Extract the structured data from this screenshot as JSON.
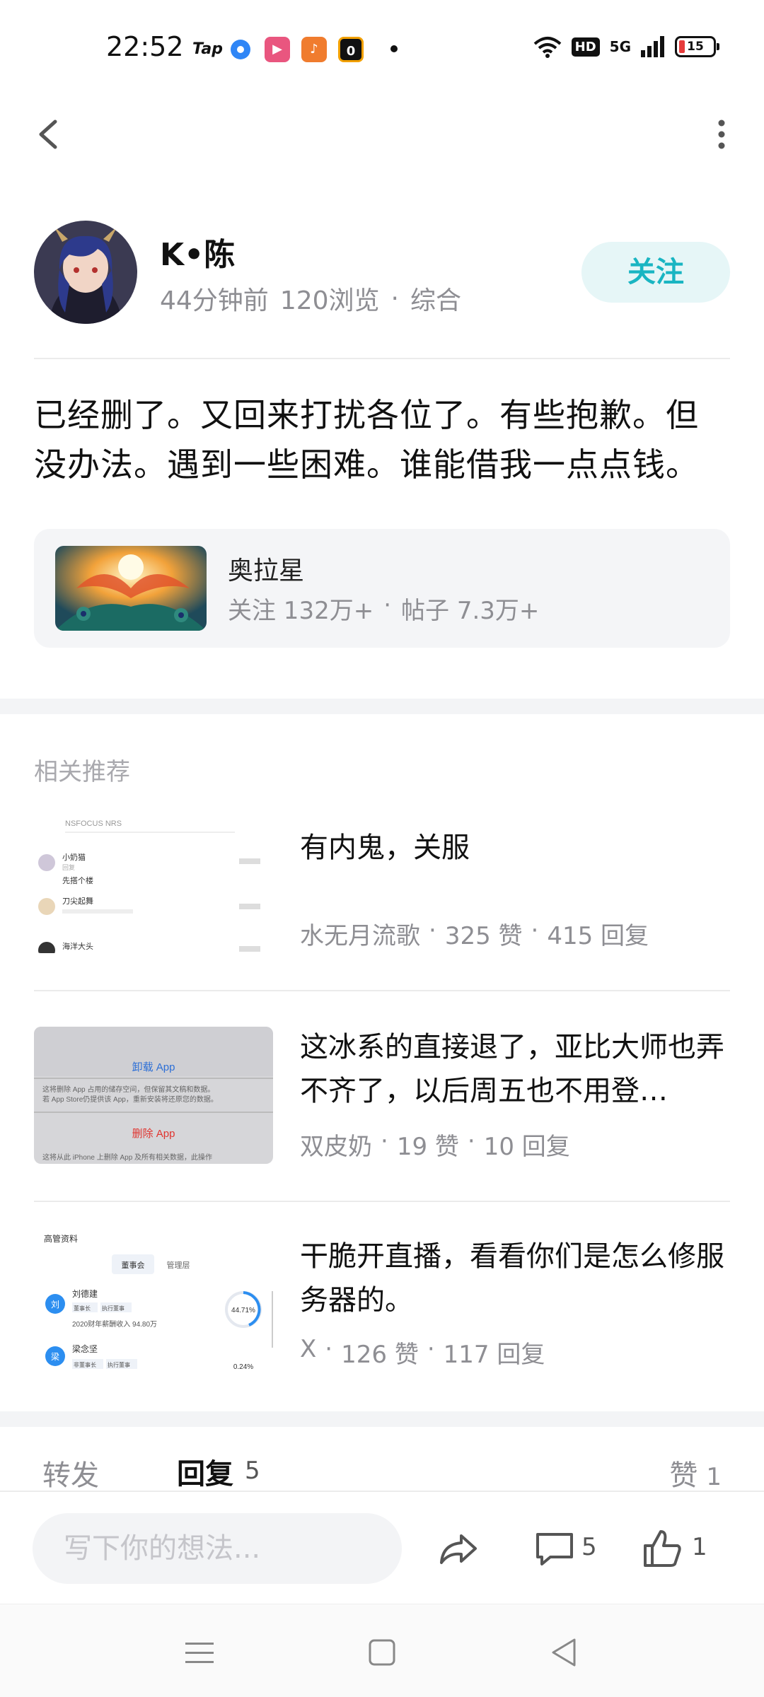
{
  "status_bar": {
    "time": "22:52",
    "tap_label": "Tap",
    "battery": "15",
    "network": "5G",
    "hd": "HD"
  },
  "author": {
    "name": "K•陈",
    "time_ago": "44分钟前",
    "views": "120浏览",
    "category": "综合",
    "follow_label": "关注"
  },
  "post": {
    "body": "已经删了。又回来打扰各位了。有些抱歉。但没办法。遇到一些困难。谁能借我一点点钱。"
  },
  "circle": {
    "name": "奥拉星",
    "followers": "关注 132万+",
    "posts": "帖子 7.3万+"
  },
  "recommend": {
    "section_title": "相关推荐",
    "items": [
      {
        "title": "有内鬼，关服",
        "author": "水无月流歌",
        "likes": "325 赞",
        "replies": "415 回复"
      },
      {
        "title": "这冰系的直接退了，亚比大师也弄不齐了，以后周五也不用登…",
        "author": "双皮奶",
        "likes": "19 赞",
        "replies": "10 回复"
      },
      {
        "title": "干脆开直播，看看你们是怎么修服务器的。",
        "author": "X",
        "likes": "126 赞",
        "replies": "117 回复"
      }
    ],
    "thumb1": {
      "top_text": "NSFOCUS NRS",
      "rows": [
        "小奶猫",
        "回复",
        "刀尖起舞",
        "海洋大头"
      ],
      "subtext": "先搭个楼"
    },
    "thumb2": {
      "action1": "卸载 App",
      "desc1": "这将删除 App 占用的储存空间，但保留其文稿和数据。若 App Store仍提供该 App，重新安装将还原您的数据。",
      "action2": "删除 App",
      "desc2": "这将从此 iPhone 上删除 App 及所有相关数据，此操作"
    },
    "thumb3": {
      "header": "高管资料",
      "tab1": "董事会",
      "tab2": "管理层",
      "person1_tag": "刘",
      "person1": "刘德建",
      "person1_role1": "董事长",
      "person1_role2": "执行董事",
      "person1_income": "2020财年薪酬收入 94.80万",
      "person1_pct": "44.71%",
      "person2_tag": "梁",
      "person2": "梁念坚",
      "person2_role1": "非董事长",
      "person2_role2": "执行董事",
      "person2_pct": "0.24%"
    }
  },
  "tabs": {
    "share": "转发",
    "reply": "回复",
    "reply_count": "5",
    "like": "赞",
    "like_count": "1"
  },
  "bottom_bar": {
    "input_placeholder": "写下你的想法...",
    "comment_count": "5",
    "like_count": "1"
  },
  "icons": {
    "back": "chevron-left-icon",
    "more": "more-vertical-icon",
    "share": "share-arrow-icon",
    "comment": "comment-icon",
    "like": "thumbs-up-icon"
  },
  "colors": {
    "accent": "#19b5c2",
    "accent_bg": "#e6f6f7",
    "muted": "#8e8e93"
  }
}
